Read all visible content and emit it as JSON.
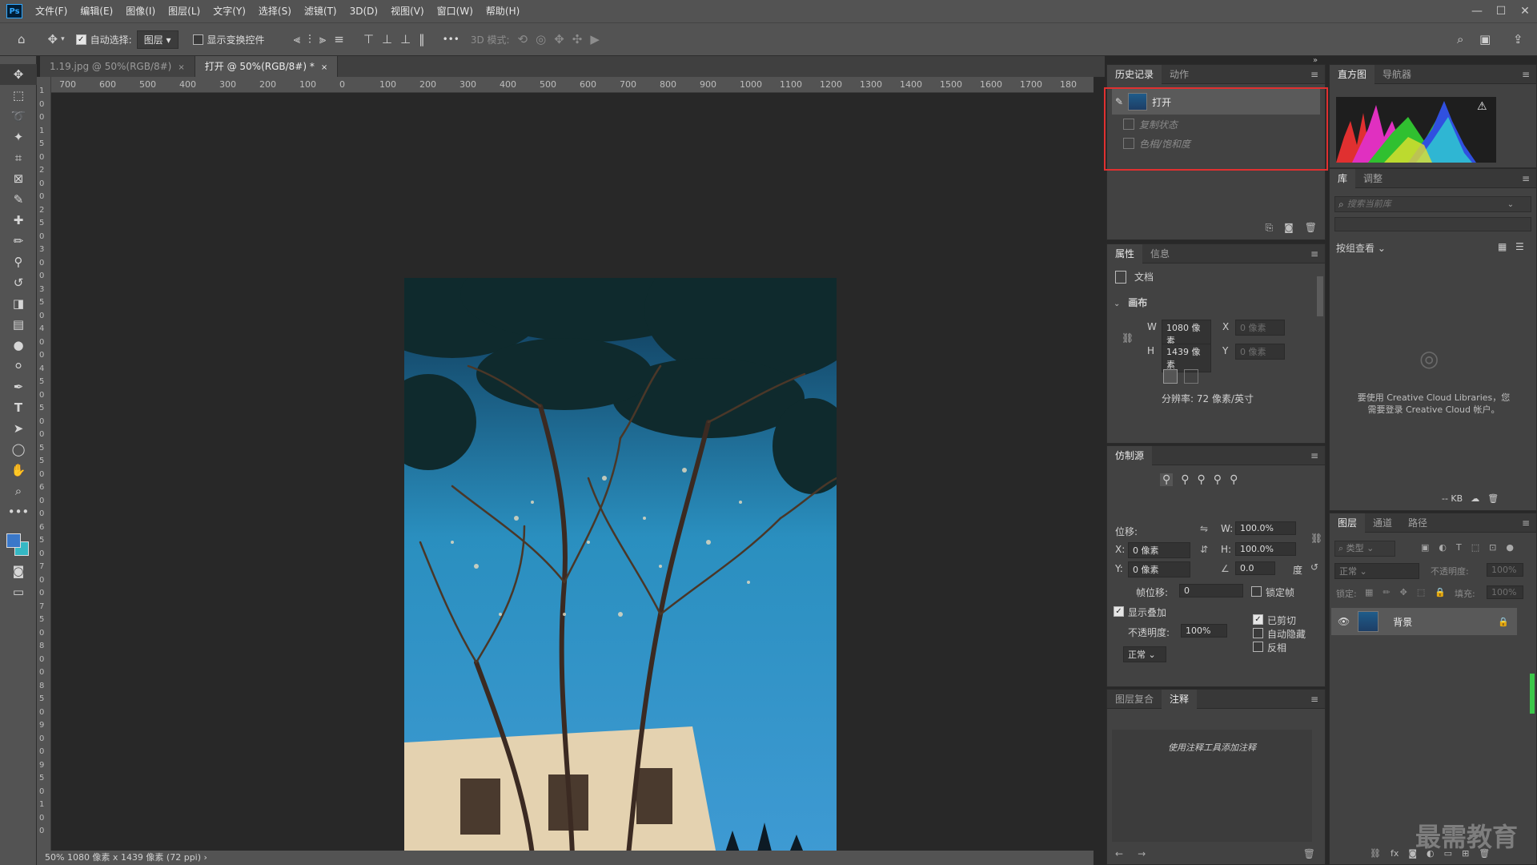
{
  "app": {
    "logo": "Ps"
  },
  "menu": [
    "文件(F)",
    "编辑(E)",
    "图像(I)",
    "图层(L)",
    "文字(Y)",
    "选择(S)",
    "滤镜(T)",
    "3D(D)",
    "视图(V)",
    "窗口(W)",
    "帮助(H)"
  ],
  "window_controls": {
    "minimize": "—",
    "maximize": "☐",
    "close": "✕"
  },
  "options_bar": {
    "auto_select_label": "自动选择:",
    "auto_select_target": "图层",
    "show_transform_label": "显示变换控件",
    "more": "•••",
    "mode_3d_label": "3D 模式:"
  },
  "doc_tabs": [
    {
      "label": "1.19.jpg @ 50%(RGB/8#)",
      "close": "×"
    },
    {
      "label": "打开 @ 50%(RGB/8#) *",
      "close": "×"
    }
  ],
  "ruler_top": [
    "700",
    "600",
    "500",
    "400",
    "300",
    "200",
    "100",
    "0",
    "100",
    "200",
    "300",
    "400",
    "500",
    "600",
    "700",
    "800",
    "900",
    "1000",
    "1100",
    "1200",
    "1300",
    "1400",
    "1500",
    "1600",
    "1700",
    "180"
  ],
  "ruler_left": [
    "1",
    "0",
    "0",
    "1",
    "5",
    "0",
    "2",
    "0",
    "0",
    "2",
    "5",
    "0",
    "3",
    "0",
    "0",
    "3",
    "5",
    "0",
    "4",
    "0",
    "0",
    "4",
    "5",
    "0",
    "5",
    "0",
    "0",
    "5",
    "5",
    "0",
    "6",
    "0",
    "0",
    "6",
    "5",
    "0",
    "7",
    "0",
    "0",
    "7",
    "5",
    "0",
    "8",
    "0",
    "0",
    "8",
    "5",
    "0",
    "9",
    "0",
    "0",
    "9",
    "5",
    "0",
    "1",
    "0",
    "0"
  ],
  "status": "50%   1080 像素 x 1439 像素 (72 ppi)  ›",
  "history_panel": {
    "tabs": [
      "历史记录",
      "动作"
    ],
    "items": [
      "打开",
      "复制状态",
      "色相/饱和度"
    ]
  },
  "histogram_panel": {
    "tabs": [
      "直方图",
      "导航器"
    ],
    "warning": "⚠"
  },
  "library_panel": {
    "tabs": [
      "库",
      "调整"
    ],
    "search_placeholder": "搜索当前库",
    "view_label": "按组查看 ⌄",
    "message_line1": "要使用 Creative Cloud Libraries，您",
    "message_line2": "需要登录 Creative Cloud 帐户。",
    "kb": "-- KB"
  },
  "properties_panel": {
    "tabs": [
      "属性",
      "信息"
    ],
    "doc_label": "文档",
    "section": "画布",
    "w_label": "W",
    "w_value": "1080 像素",
    "h_label": "H",
    "h_value": "1439 像素",
    "x_label": "X",
    "x_value": "0 像素",
    "y_label": "Y",
    "y_value": "0 像素",
    "resolution": "分辨率: 72 像素/英寸"
  },
  "clone_panel": {
    "tab": "仿制源",
    "offset_label": "位移:",
    "x_label": "X:",
    "x_value": "0 像素",
    "y_label": "Y:",
    "y_value": "0 像素",
    "w_label": "W:",
    "w_value": "100.0%",
    "h_label": "H:",
    "h_value": "100.0%",
    "angle_value": "0.0",
    "degree": "度",
    "frame_offset_label": "帧位移:",
    "frame_offset_value": "0",
    "lock_frame_label": "锁定帧",
    "show_overlay_label": "显示叠加",
    "opacity_label": "不透明度:",
    "opacity_value": "100%",
    "blend": "正常",
    "clipped_label": "已剪切",
    "auto_hide_label": "自动隐藏",
    "invert_label": "反相"
  },
  "notes_panel": {
    "tabs": [
      "图层复合",
      "注释"
    ],
    "message": "使用注释工具添加注释"
  },
  "layers_panel": {
    "tabs": [
      "图层",
      "通道",
      "路径"
    ],
    "filter_label": "类型",
    "blend": "正常",
    "opacity_label": "不透明度:",
    "opacity_value": "100%",
    "lock_label": "锁定:",
    "fill_label": "填充:",
    "fill_value": "100%",
    "layer_name": "背景"
  },
  "watermark": "最需教育",
  "colors": {
    "highlight": "#e03030",
    "accent": "#31a8ff"
  }
}
